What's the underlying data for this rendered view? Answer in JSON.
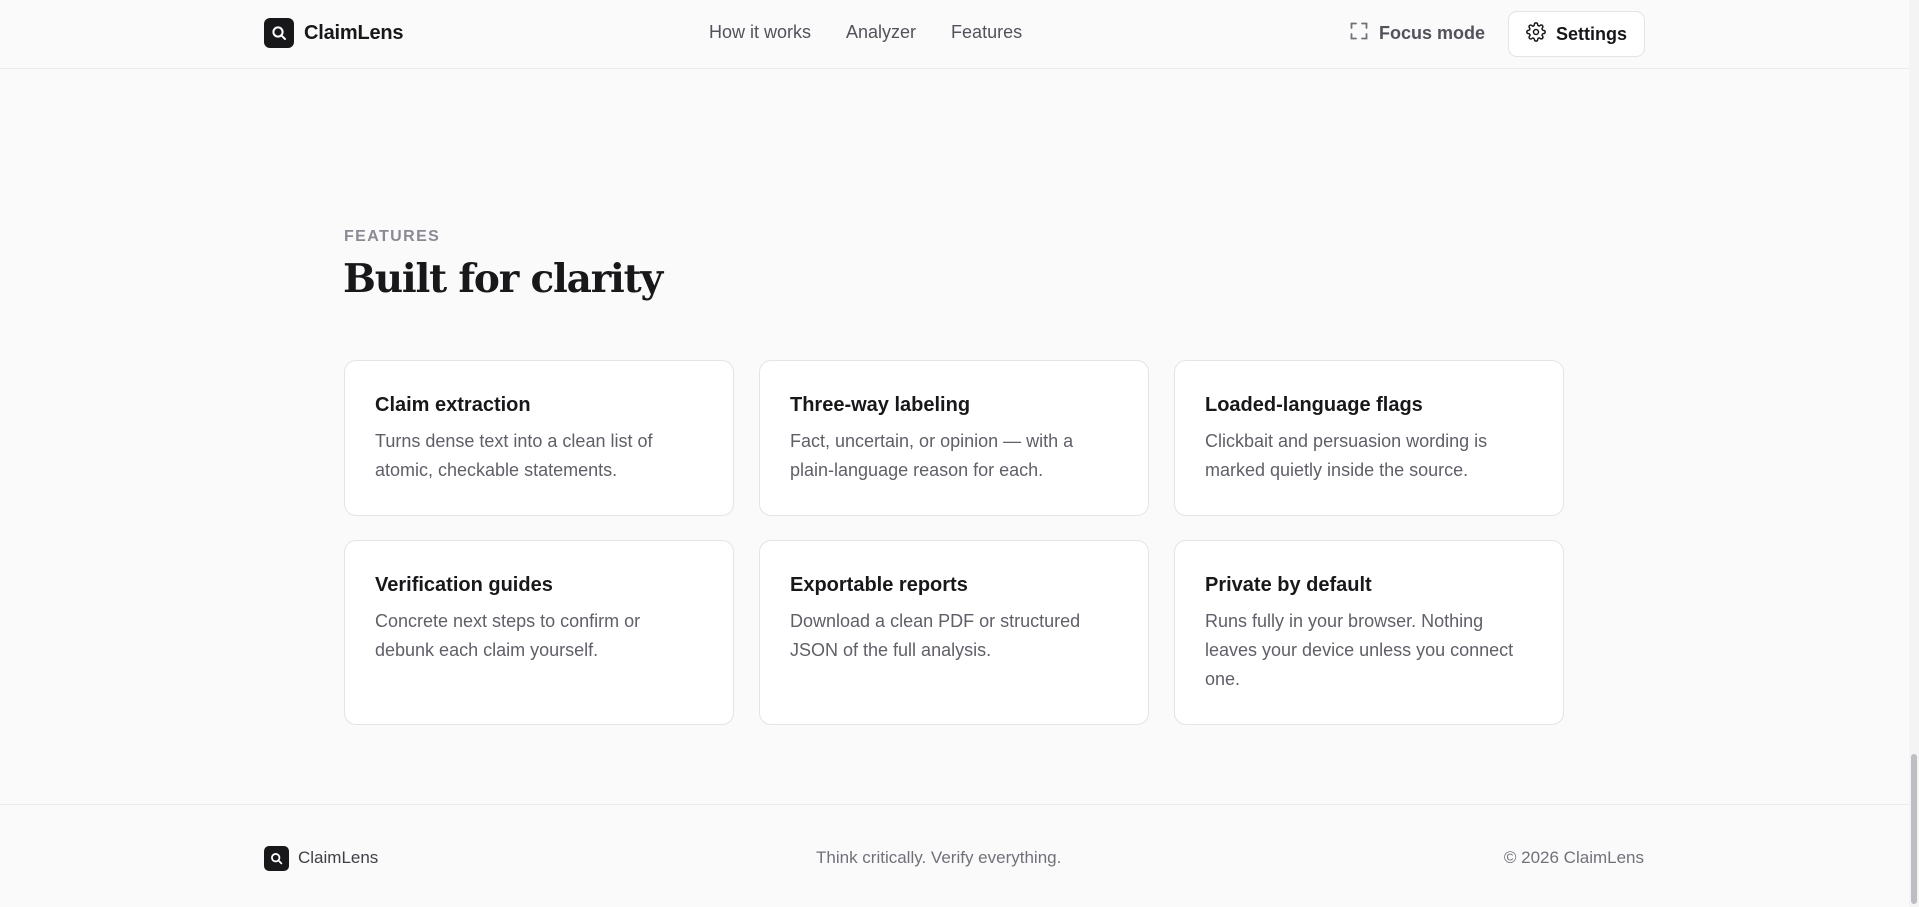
{
  "header": {
    "brand": "ClaimLens",
    "nav": [
      "How it works",
      "Analyzer",
      "Features"
    ],
    "focus_label": "Focus mode",
    "settings_label": "Settings"
  },
  "features": {
    "eyebrow": "FEATURES",
    "title": "Built for clarity",
    "cards": [
      {
        "title": "Claim extraction",
        "desc": "Turns dense text into a clean list of atomic, checkable statements."
      },
      {
        "title": "Three-way labeling",
        "desc": "Fact, uncertain, or opinion — with a plain-language reason for each."
      },
      {
        "title": "Loaded-language flags",
        "desc": "Clickbait and persuasion wording is marked quietly inside the source."
      },
      {
        "title": "Verification guides",
        "desc": "Concrete next steps to confirm or debunk each claim yourself."
      },
      {
        "title": "Exportable reports",
        "desc": "Download a clean PDF or structured JSON of the full analysis."
      },
      {
        "title": "Private by default",
        "desc": "Runs fully in your browser. Nothing leaves your device unless you connect one."
      }
    ]
  },
  "footer": {
    "brand": "ClaimLens",
    "tagline": "Think critically. Verify everything.",
    "copyright": "© 2026 ClaimLens"
  },
  "colors": {
    "background": "#fafafb",
    "text": "#18181b",
    "muted": "#5f5f68",
    "border": "#e4e4e7"
  },
  "icons": {
    "logo": "search-icon",
    "focus": "expand-corners-icon",
    "settings": "gear-icon"
  }
}
